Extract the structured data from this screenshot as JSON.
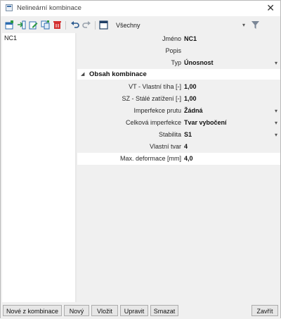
{
  "window": {
    "title": "Nelineární kombinace",
    "close_glyph": "✕"
  },
  "toolbar": {
    "icons": [
      "new-table-icon",
      "insert-icon",
      "edit-icon",
      "copy-icon",
      "delete-icon",
      "undo-icon",
      "redo-icon",
      "table-view-icon"
    ],
    "filter_label": "Všechny",
    "filter_arrow": "▾",
    "funnel_icon": "filter-icon"
  },
  "list": {
    "items": [
      "NC1"
    ]
  },
  "properties": {
    "name_label": "Jméno",
    "name_value": "NC1",
    "desc_label": "Popis",
    "desc_value": "",
    "type_label": "Typ",
    "type_value": "Únosnost",
    "section_title": "Obsah kombinace",
    "vt_label": "VT - Vlastní tíha [-]",
    "vt_value": "1,00",
    "sz_label": "SZ - Stálé zatížení [-]",
    "sz_value": "1,00",
    "imp_label": "Imperfekce prutu",
    "imp_value": "Žádná",
    "global_imp_label": "Celková imperfekce",
    "global_imp_value": "Tvar vybočení",
    "stab_label": "Stabilita",
    "stab_value": "S1",
    "mode_label": "Vlastní tvar",
    "mode_value": "4",
    "defl_label": "Max. deformace [mm]",
    "defl_value": "4,0",
    "dropdown_glyph": "▾",
    "collapse_glyph": "◢"
  },
  "buttons": {
    "new_from": "Nové z kombinace",
    "new": "Nový",
    "insert": "Vložit",
    "edit": "Upravit",
    "delete": "Smazat",
    "close": "Zavřít"
  },
  "colors": {
    "accent_blue": "#2b6cb0",
    "delete_red": "#d32f2f",
    "green": "#2e9a45"
  }
}
